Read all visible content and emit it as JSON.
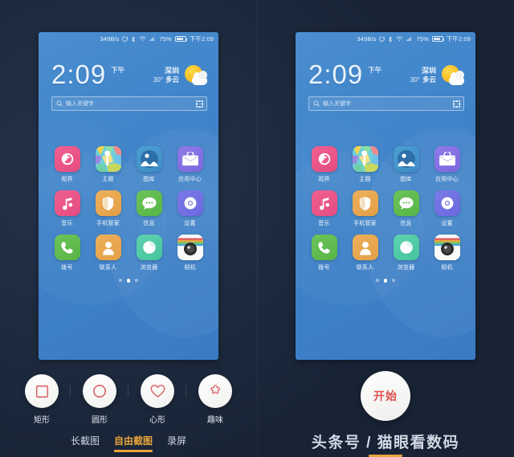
{
  "theme": {
    "background": "#1d2a3e",
    "accent": "#e8a33a",
    "start_color": "#e0514f",
    "phone_wallpaper": "#3f83c9"
  },
  "phone": {
    "status_bar": {
      "network_speed": "349B/s",
      "icons": [
        "sync-icon",
        "bluetooth-icon",
        "wifi-icon",
        "signal-icon"
      ],
      "battery_percent": "75%",
      "battery_icon": "battery-icon",
      "time": "下午2:09"
    },
    "clock": {
      "time": "2:09",
      "ampm": "下午"
    },
    "weather": {
      "city": "深圳",
      "temperature": "30°",
      "condition": "多云",
      "icon": "sun-cloud-icon"
    },
    "search": {
      "placeholder": "输入关键字",
      "search_icon": "search-icon",
      "qr_icon": "qr-code-icon"
    },
    "apps": [
      [
        {
          "label": "视界",
          "icon": "shijie-icon",
          "cls": "ic-shijie"
        },
        {
          "label": "主题",
          "icon": "theme-icon",
          "cls": "ic-zhuti"
        },
        {
          "label": "图库",
          "icon": "gallery-icon",
          "cls": "ic-tuku"
        },
        {
          "label": "应用中心",
          "icon": "app-center-icon",
          "cls": "ic-appctr"
        }
      ],
      [
        {
          "label": "音乐",
          "icon": "music-icon",
          "cls": "ic-yinyue"
        },
        {
          "label": "手机管家",
          "icon": "shield-icon",
          "cls": "ic-guanjia"
        },
        {
          "label": "信息",
          "icon": "message-icon",
          "cls": "ic-xinxi"
        },
        {
          "label": "设置",
          "icon": "settings-gear-icon",
          "cls": "ic-shezhi"
        }
      ],
      [
        {
          "label": "拨号",
          "icon": "phone-icon",
          "cls": "ic-bohao"
        },
        {
          "label": "联系人",
          "icon": "contacts-icon",
          "cls": "ic-lianxi"
        },
        {
          "label": "浏览器",
          "icon": "browser-icon",
          "cls": "ic-liulan"
        },
        {
          "label": "相机",
          "icon": "camera-icon",
          "cls": "ic-xiangji"
        }
      ]
    ],
    "page_dots": {
      "count": 3,
      "active_index": 1
    }
  },
  "shape_tools": [
    {
      "label": "矩形",
      "icon": "square-shape-icon"
    },
    {
      "label": "圆形",
      "icon": "circle-shape-icon"
    },
    {
      "label": "心形",
      "icon": "heart-shape-icon"
    },
    {
      "label": "趣味",
      "icon": "fun-star-shape-icon"
    }
  ],
  "tabs": [
    {
      "label": "长截图",
      "active": false
    },
    {
      "label": "自由截图",
      "active": true
    },
    {
      "label": "录屏",
      "active": false
    }
  ],
  "start_button": {
    "label": "开始"
  },
  "watermark": {
    "text": "头条号 / 猫眼看数码"
  }
}
